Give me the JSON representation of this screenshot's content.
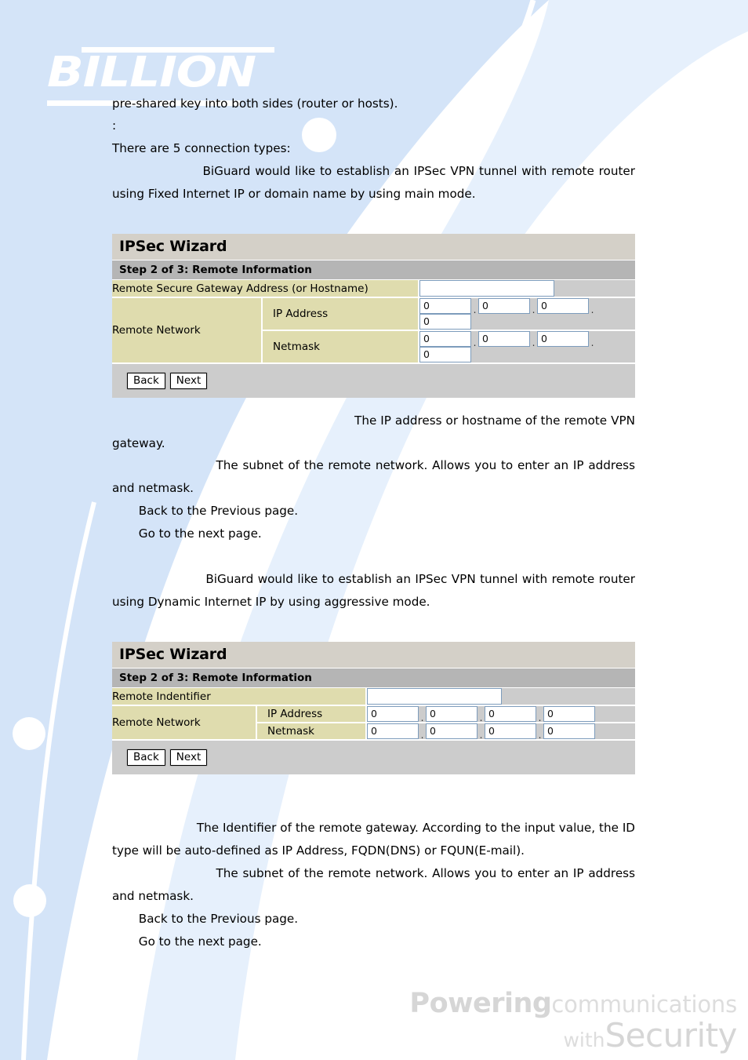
{
  "document": {
    "brand_logo": "BILLION",
    "footer_tagline": {
      "word_powering": "Powering",
      "word_communications": "communications",
      "word_with": "with",
      "word_security": "Security"
    }
  },
  "colors": {
    "swoosh_blue": "#d3e3f7",
    "swoosh_blue_light": "#e3eefb",
    "label_khaki": "#dfdcae",
    "panel_gray": "#cccccc",
    "title_gray": "#d4d0c8",
    "subtitle_gray": "#b5b5b5",
    "input_border": "#7d9cbc",
    "tagline_gray": "#d9d9d9"
  },
  "body_text": {
    "p1": "pre-shared key into both sides (router or hosts).",
    "p2": ":",
    "p3": "There are 5 connection types:",
    "p4": "                    BiGuard would like to establish an IPSec VPN tunnel with remote router using Fixed Internet IP or domain name by using main mode.",
    "p5": "                                                              The IP address or hostname of the remote VPN gateway.",
    "p6": "                       The subnet of the remote network. Allows you to enter an IP address and netmask.",
    "p7": "       Back to the Previous page.",
    "p8": "       Go to the next page.",
    "p9": "                      BiGuard would like to establish an IPSec VPN tunnel with remote router using Dynamic Internet IP by using aggressive mode.",
    "p10": "                      The Identifier of the remote gateway. According to the input value, the ID type will be auto-defined as IP Address, FQDN(DNS) or FQUN(E-mail).",
    "p11": "                       The subnet of the remote network. Allows you to enter an IP address and netmask.",
    "p12": "       Back to the Previous page.",
    "p13": "       Go to the next page."
  },
  "wizard_one": {
    "title": "IPSec Wizard",
    "step_header": "Step 2 of 3: Remote Information",
    "gateway_label": "Remote Secure Gateway Address (or Hostname)",
    "gateway_value": "",
    "network_label": "Remote Network",
    "ip_label": "IP Address",
    "netmask_label": "Netmask",
    "ip_octets": [
      "0",
      "0",
      "0",
      "0"
    ],
    "netmask_octets": [
      "0",
      "0",
      "0",
      "0"
    ],
    "separator": ".",
    "back_button": "Back",
    "next_button": "Next"
  },
  "wizard_two": {
    "title": "IPSec Wizard",
    "step_header": "Step 2 of 3: Remote Information",
    "identifier_label": "Remote Indentifier",
    "identifier_value": "",
    "network_label": "Remote Network",
    "ip_label": "IP Address",
    "netmask_label": "Netmask",
    "ip_octets": [
      "0",
      "0",
      "0",
      "0"
    ],
    "netmask_octets": [
      "0",
      "0",
      "0",
      "0"
    ],
    "separator": ".",
    "back_button": "Back",
    "next_button": "Next"
  }
}
